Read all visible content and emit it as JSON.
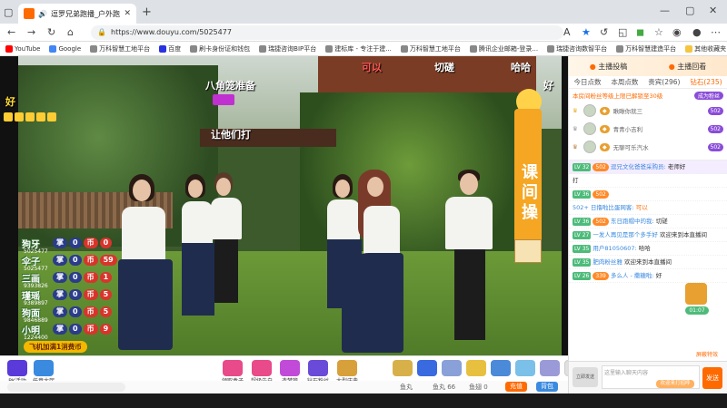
{
  "browser": {
    "tab_title": "逗罗兄弟跑播_户外跑播_斗",
    "url": "https://www.douyu.com/5025477",
    "bookmarks": [
      "YouTube",
      "Google",
      "万科智慧工地平台",
      "百度",
      "刷卡身份证和钱包",
      "瑞捷咨询BIP平台",
      "建标库 - 专注于建...",
      "万科智慧工地平台",
      "腾讯企业邮箱-登录...",
      "瑞捷咨询数智平台",
      "万科智慧建造平台"
    ],
    "bookmarks_more": "其他收藏夹"
  },
  "video": {
    "danmaku": [
      {
        "text": "可以"
      },
      {
        "text": "切磋"
      },
      {
        "text": "哈哈"
      },
      {
        "text": "好"
      },
      {
        "text": "八角笼准备"
      },
      {
        "text": "让他们打"
      },
      {
        "text": "好"
      }
    ],
    "board_text": "课间操",
    "scores": [
      {
        "name": "狗牙",
        "n1": "0",
        "n2": "0",
        "sub": "5025477"
      },
      {
        "name": "伞子",
        "n1": "0",
        "n2": "59",
        "sub": "5025477"
      },
      {
        "name": "三画",
        "n1": "0",
        "n2": "1",
        "sub": "9393826"
      },
      {
        "name": "瑾瑶",
        "n1": "0",
        "n2": "5",
        "sub": "9389897"
      },
      {
        "name": "狗面",
        "n1": "0",
        "n2": "5",
        "sub": "9846889"
      },
      {
        "name": "小明",
        "n1": "0",
        "n2": "9",
        "sub": "1224400"
      }
    ],
    "score_labels": [
      "掌",
      "币"
    ],
    "bottom_banner": "飞机加满1消费币"
  },
  "toolbar": {
    "left_items": [
      "PK活动",
      "任意大厅"
    ],
    "gift_items": [
      "领取盒子",
      "超级告白",
      "造梦管",
      "钻石粉丝",
      "大型庆典"
    ],
    "status": {
      "fish_ball": "鱼丸",
      "fish_count": "鱼丸 66",
      "fish_ball2": "鱼翅 0",
      "btn_recharge": "充值",
      "btn_backpack": "背包"
    }
  },
  "panel": {
    "head_left": "主播投稿",
    "head_right": "主播回看",
    "tabs": [
      "今日点数",
      "本周点数",
      "贵宾(296)",
      "钻石(235)"
    ],
    "notice": "本房间粉丝等级上限已解锁至30级",
    "notice_btn": "成为粉丝",
    "ranks": [
      {
        "name": "瞅瞅你就三",
        "fan": "502"
      },
      {
        "name": "青青小吉利",
        "fan": "502"
      },
      {
        "name": "无聊可乐汽水",
        "fan": "502"
      }
    ],
    "chats": [
      {
        "lvl": "LV 32",
        "fan": "502",
        "name": "逗兄文化爸爸采购员:",
        "text": "老师好"
      },
      {
        "lvl": "",
        "fan": "",
        "name": "",
        "text": "打"
      },
      {
        "lvl": "LV 36",
        "fan": "502",
        "name": "",
        "text": ""
      },
      {
        "lvl": "",
        "fan": "",
        "name": "502+ 日撸啦比蛋网客:",
        "text": "可以"
      },
      {
        "lvl": "LV 36",
        "fan": "502",
        "name": "东日跑帽中的我:",
        "text": "切磋"
      },
      {
        "lvl": "LV 27",
        "fan": "",
        "name": "一发人再见是那个多手好",
        "text": "欢迎来到本直播间"
      },
      {
        "lvl": "LV 35",
        "fan": "",
        "name": "用户81050607:",
        "text": "哈哈"
      },
      {
        "lvl": "LV 35",
        "fan": "",
        "name": "肥肉粉丝雅",
        "text": "欢迎来到本直播间"
      },
      {
        "lvl": "LV 26",
        "fan": "339",
        "name": "多么人 - 撒糖啦:",
        "text": "好"
      }
    ],
    "chest_time": "01:07",
    "screen_toggle": "屏蔽特效",
    "input_placeholder": "这里输入聊天内容",
    "input_btn": "欢迎来打招呼",
    "input_badge": "立即发送",
    "send_label": "发送"
  }
}
